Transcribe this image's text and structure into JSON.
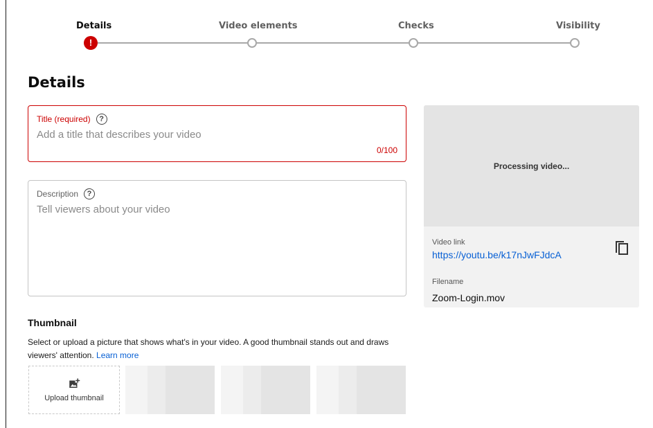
{
  "stepper": {
    "steps": [
      {
        "label": "Details",
        "state": "error"
      },
      {
        "label": "Video elements",
        "state": "pending"
      },
      {
        "label": "Checks",
        "state": "pending"
      },
      {
        "label": "Visibility",
        "state": "pending"
      }
    ],
    "error_glyph": "!"
  },
  "page": {
    "heading": "Details"
  },
  "title_field": {
    "label": "Title (required)",
    "value": "",
    "placeholder": "Add a title that describes your video",
    "counter": "0/100",
    "help_icon": "help-circle-icon"
  },
  "description_field": {
    "label": "Description",
    "value": "",
    "placeholder": "Tell viewers about your video",
    "help_icon": "help-circle-icon"
  },
  "thumbnail": {
    "heading": "Thumbnail",
    "description": "Select or upload a picture that shows what's in your video. A good thumbnail stands out and draws viewers' attention.",
    "learn_more": "Learn more",
    "upload_label": "Upload thumbnail",
    "upload_icon": "add-photo-icon"
  },
  "preview": {
    "status": "Processing video...",
    "video_link_label": "Video link",
    "video_link": "https://youtu.be/k17nJwFJdcA",
    "filename_label": "Filename",
    "filename": "Zoom-Login.mov",
    "copy_icon": "copy-icon"
  },
  "colors": {
    "error": "#cc0000",
    "link": "#065fd4",
    "step_inactive": "#a8a8a8"
  }
}
